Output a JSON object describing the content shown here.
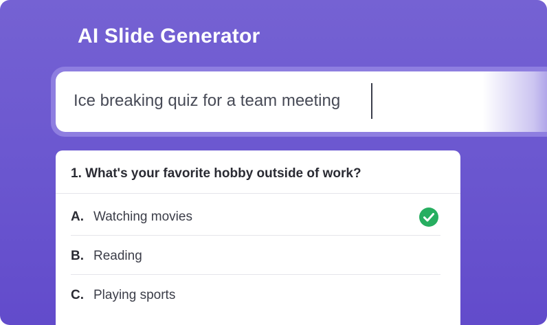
{
  "app": {
    "title": "AI Slide Generator"
  },
  "prompt": {
    "value": "Ice breaking quiz for a team meeting"
  },
  "quiz": {
    "question": "1. What's your favorite hobby outside of work?",
    "options": [
      {
        "letter": "A.",
        "label": "Watching movies",
        "selected": true
      },
      {
        "letter": "B.",
        "label": "Reading",
        "selected": false
      },
      {
        "letter": "C.",
        "label": "Playing sports",
        "selected": false
      }
    ]
  },
  "colors": {
    "background": "#6a56cf",
    "check": "#27ae60",
    "card": "#ffffff"
  },
  "icons": {
    "selected": "check-circle-icon"
  }
}
